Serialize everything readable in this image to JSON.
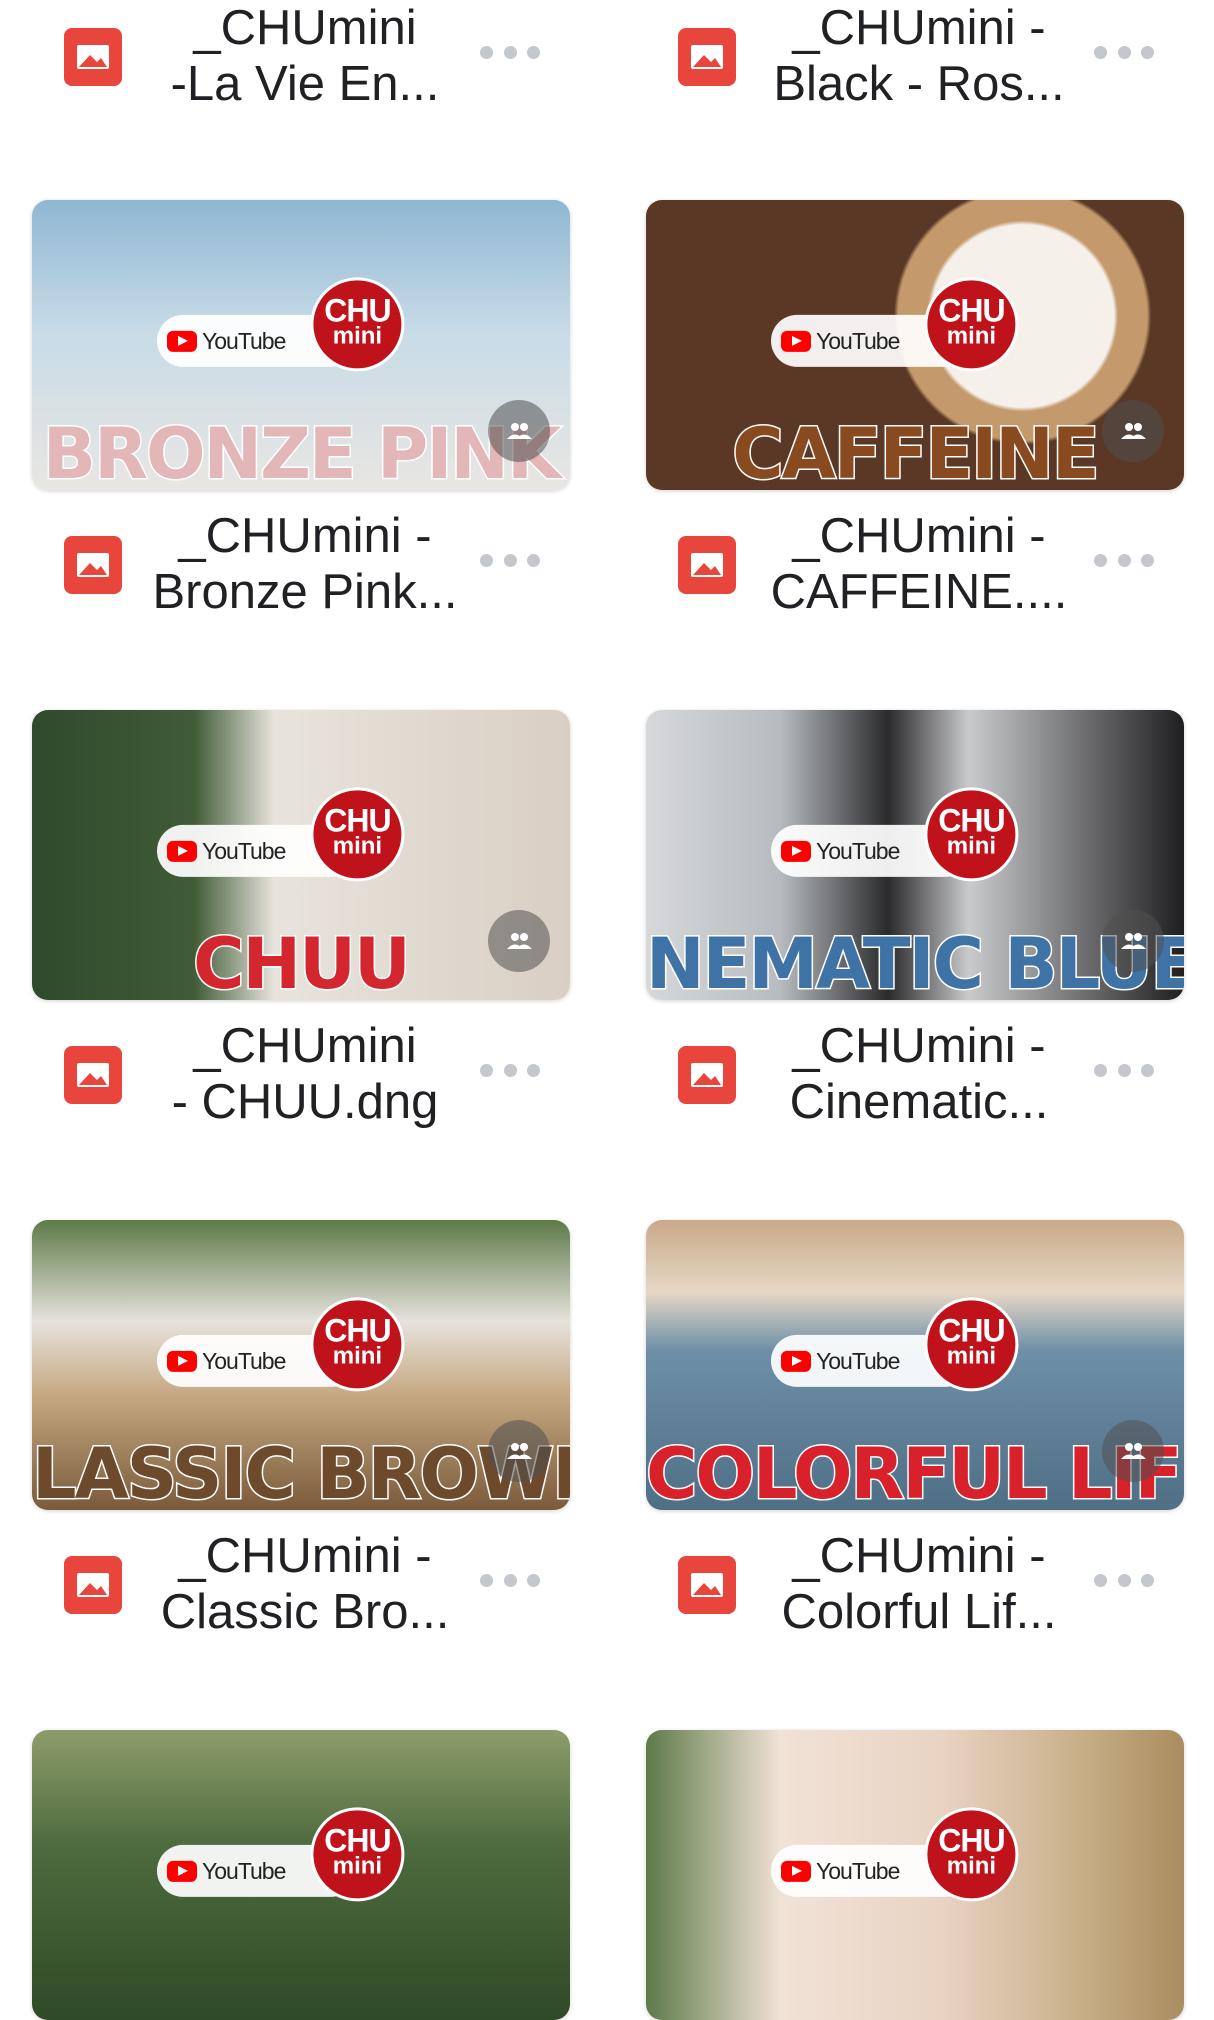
{
  "files": [
    {
      "line1": "_CHUmini",
      "line2": "-La Vie En...",
      "banner": "",
      "bg": "#ffffff",
      "banner_color": "#000000"
    },
    {
      "line1": "_CHUmini -",
      "line2": "Black - Ros...",
      "banner": "",
      "bg": "#ffffff",
      "banner_color": "#000000"
    },
    {
      "line1": "_CHUmini -",
      "line2": "Bronze Pink...",
      "banner": "BRONZE PINK",
      "bg": "#a9c9de",
      "banner_color": "#e3b7b8"
    },
    {
      "line1": "_CHUmini -",
      "line2": "CAFFEINE....",
      "banner": "CAFFEINE",
      "bg": "#5a3825",
      "banner_color": "#8a4a1f"
    },
    {
      "line1": "_CHUmini",
      "line2": "- CHUU.dng",
      "banner": "CHUU",
      "bg": "#d9cfc4",
      "banner_color": "#d4262e"
    },
    {
      "line1": "_CHUmini -",
      "line2": "Cinematic...",
      "banner": "NEMATIC BLUE",
      "bg": "#9ea3a8",
      "banner_color": "#3f73a6"
    },
    {
      "line1": "_CHUmini -",
      "line2": "Classic Bro...",
      "banner": "LASSIC BROWN",
      "bg": "#b49a7c",
      "banner_color": "#6e4a2c"
    },
    {
      "line1": "_CHUmini -",
      "line2": "Colorful Lif...",
      "banner": "COLORFUL LIFE",
      "bg": "#6d8fa8",
      "banner_color": "#d8212a"
    },
    {
      "line1": "",
      "line2": "",
      "banner": "",
      "bg": "#4d6b3e",
      "banner_color": "#000000"
    },
    {
      "line1": "",
      "line2": "",
      "banner": "",
      "bg": "#c9b79a",
      "banner_color": "#000000"
    }
  ],
  "badge": {
    "youtube_label": "YouTube",
    "chu_top": "CHU",
    "chu_bottom": "mini"
  },
  "icons": {
    "file": "image-file-icon",
    "more": "more-options-icon",
    "shared": "shared-people-icon"
  }
}
